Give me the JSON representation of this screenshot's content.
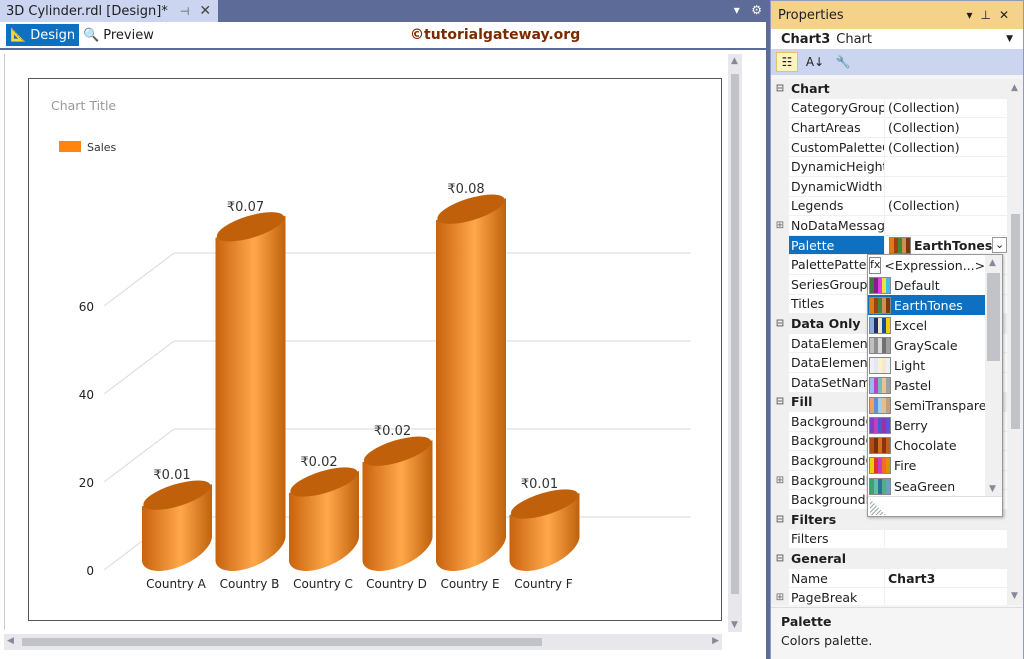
{
  "document_tab": {
    "title": "3D Cylinder.rdl [Design]*"
  },
  "toolbar": {
    "design_label": "Design",
    "preview_label": "Preview",
    "watermark": "©tutorialgateway.org"
  },
  "chart_data": {
    "type": "bar",
    "style": "3d-cylinder",
    "title": "Chart Title",
    "legend": {
      "position": "top-left",
      "entries": [
        "Sales"
      ]
    },
    "categories": [
      "Country A",
      "Country B",
      "Country C",
      "Country D",
      "Country E",
      "Country F"
    ],
    "series": [
      {
        "name": "Sales",
        "values": [
          12,
          73,
          15,
          22,
          77,
          10
        ],
        "color": "#f28a1e"
      }
    ],
    "data_labels": [
      "₹0.01",
      "₹0.07",
      "₹0.02",
      "₹0.02",
      "₹0.08",
      "₹0.01"
    ],
    "yticks": [
      "0",
      "20",
      "40",
      "60"
    ],
    "ylim": [
      0,
      80
    ],
    "grid": true
  },
  "properties": {
    "title": "Properties",
    "object_name": "Chart3",
    "object_type": "Chart",
    "rows": [
      {
        "type": "cat",
        "name": "Chart"
      },
      {
        "name": "CategoryGroups",
        "value": "(Collection)"
      },
      {
        "name": "ChartAreas",
        "value": "(Collection)"
      },
      {
        "name": "CustomPaletteColors",
        "value": "(Collection)"
      },
      {
        "name": "DynamicHeight",
        "value": ""
      },
      {
        "name": "DynamicWidth",
        "value": ""
      },
      {
        "name": "Legends",
        "value": "(Collection)"
      },
      {
        "name": "NoDataMessage",
        "value": "",
        "expandable": true
      },
      {
        "name": "Palette",
        "value": "EarthTones",
        "selected": true
      },
      {
        "name": "PalettePattern",
        "value": ""
      },
      {
        "name": "SeriesGroups",
        "value": ""
      },
      {
        "name": "Titles",
        "value": ""
      },
      {
        "type": "cat",
        "name": "Data Only"
      },
      {
        "name": "DataElementName",
        "value": ""
      },
      {
        "name": "DataElementOutput",
        "value": ""
      },
      {
        "name": "DataSetName",
        "value": ""
      },
      {
        "type": "cat",
        "name": "Fill"
      },
      {
        "name": "BackgroundColor",
        "value": ""
      },
      {
        "name": "BackgroundGradientEndColor",
        "value": ""
      },
      {
        "name": "BackgroundGradientType",
        "value": ""
      },
      {
        "name": "BackgroundImage",
        "value": "",
        "expandable": true
      },
      {
        "name": "BackgroundPatternType",
        "value": ""
      },
      {
        "type": "cat",
        "name": "Filters"
      },
      {
        "name": "Filters",
        "value": ""
      },
      {
        "type": "cat",
        "name": "General"
      },
      {
        "name": "Name",
        "value": "Chart3",
        "bold": true
      },
      {
        "name": "PageBreak",
        "value": "",
        "expandable": true
      }
    ],
    "description_title": "Palette",
    "description_text": "Colors palette."
  },
  "palette_dropdown": {
    "fx_label": "fx",
    "expression_label": "<Expression...>",
    "selected": "EarthTones",
    "options": [
      {
        "label": "Default",
        "colors": [
          "#3a7a3a",
          "#8b1a8b",
          "#e040e0",
          "#f0e040",
          "#40c0e0"
        ]
      },
      {
        "label": "EarthTones",
        "colors": [
          "#e07b10",
          "#a04010",
          "#3a8a3a",
          "#d09050",
          "#7a3a10"
        ]
      },
      {
        "label": "Excel",
        "colors": [
          "#8ab0e0",
          "#2a2a6a",
          "#f0e8c0",
          "#1a4aa0",
          "#f0d000"
        ]
      },
      {
        "label": "GrayScale",
        "colors": [
          "#c0c0c0",
          "#909090",
          "#d8d8d8",
          "#707070",
          "#a0a0a0"
        ]
      },
      {
        "label": "Light",
        "colors": [
          "#f0f0f0",
          "#e0e8f8",
          "#f8f0d8",
          "#f8e8c8",
          "#e8f0f8"
        ]
      },
      {
        "label": "Pastel",
        "colors": [
          "#90c0f0",
          "#c040c0",
          "#70c0c0",
          "#f0c090",
          "#a0a0a0"
        ]
      },
      {
        "label": "SemiTransparent",
        "colors": [
          "#f0a060",
          "#6090d0",
          "#a0d0f0",
          "#e0c090",
          "#c0a080"
        ]
      },
      {
        "label": "Berry",
        "colors": [
          "#8040c0",
          "#c040c0",
          "#4060d0",
          "#a030a0",
          "#6050e0"
        ]
      },
      {
        "label": "Chocolate",
        "colors": [
          "#b05010",
          "#7a3010",
          "#d07020",
          "#903010",
          "#c06020"
        ]
      },
      {
        "label": "Fire",
        "colors": [
          "#f0d000",
          "#e03030",
          "#c040c0",
          "#f07020",
          "#e09000"
        ]
      },
      {
        "label": "SeaGreen",
        "colors": [
          "#40a070",
          "#60c0a0",
          "#3070a0",
          "#50b080",
          "#70a0c0"
        ]
      }
    ]
  }
}
